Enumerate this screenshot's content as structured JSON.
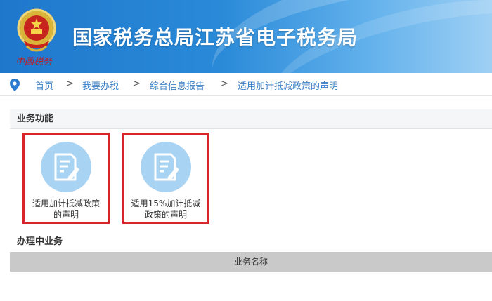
{
  "header": {
    "title": "国家税务总局江苏省电子税务局",
    "motto": "中国税务",
    "emblem_icon": "national-emblem-icon"
  },
  "breadcrumb": {
    "icon": "location-pin-icon",
    "items": [
      "首页",
      "我要办税",
      "综合信息报告",
      "适用加计抵减政策的声明"
    ],
    "separator": ">"
  },
  "business_functions": {
    "title": "业务功能",
    "cards": [
      {
        "label": "适用加计抵减政策的声明",
        "icon": "document-edit-icon"
      },
      {
        "label": "适用15%加计抵减政策的声明",
        "icon": "document-edit-icon"
      }
    ]
  },
  "in_progress": {
    "title": "办理中业务",
    "table_header": "业务名称"
  },
  "colors": {
    "header_blue": "#1f77cc",
    "link_blue": "#3a7fc6",
    "highlight_red": "#d7252b",
    "icon_circle": "#a9d3f2"
  }
}
